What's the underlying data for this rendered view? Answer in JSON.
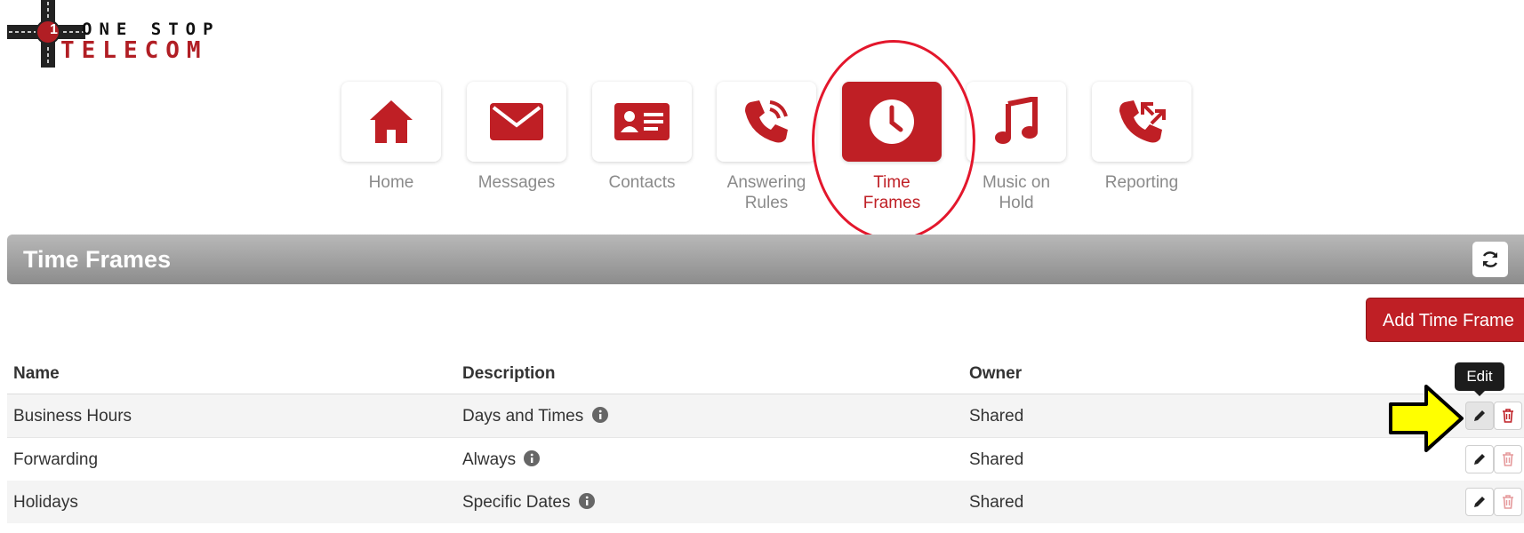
{
  "logo": {
    "line1": "ONE STOP",
    "line2": "TELECOM",
    "badge": "1"
  },
  "nav": [
    {
      "label": "Home",
      "icon": "home-icon",
      "active": false
    },
    {
      "label": "Messages",
      "icon": "envelope-icon",
      "active": false
    },
    {
      "label": "Contacts",
      "icon": "contact-card-icon",
      "active": false
    },
    {
      "label": "Answering\nRules",
      "icon": "phone-ringing-icon",
      "active": false
    },
    {
      "label": "Time\nFrames",
      "icon": "clock-icon",
      "active": true
    },
    {
      "label": "Music on\nHold",
      "icon": "music-note-icon",
      "active": false
    },
    {
      "label": "Reporting",
      "icon": "phone-arrows-icon",
      "active": false
    }
  ],
  "header": {
    "title": "Time Frames",
    "refresh_icon": "refresh-icon"
  },
  "add_button_label": "Add Time Frame",
  "table": {
    "columns": [
      "Name",
      "Description",
      "Owner"
    ],
    "rows": [
      {
        "name": "Business Hours",
        "description": "Days and Times",
        "owner": "Shared"
      },
      {
        "name": "Forwarding",
        "description": "Always",
        "owner": "Shared"
      },
      {
        "name": "Holidays",
        "description": "Specific Dates",
        "owner": "Shared"
      }
    ]
  },
  "tooltip": "Edit",
  "colors": {
    "brand_red": "#bf1f25",
    "annotation_red": "#e3172c",
    "annotation_yellow": "#ffff00"
  }
}
